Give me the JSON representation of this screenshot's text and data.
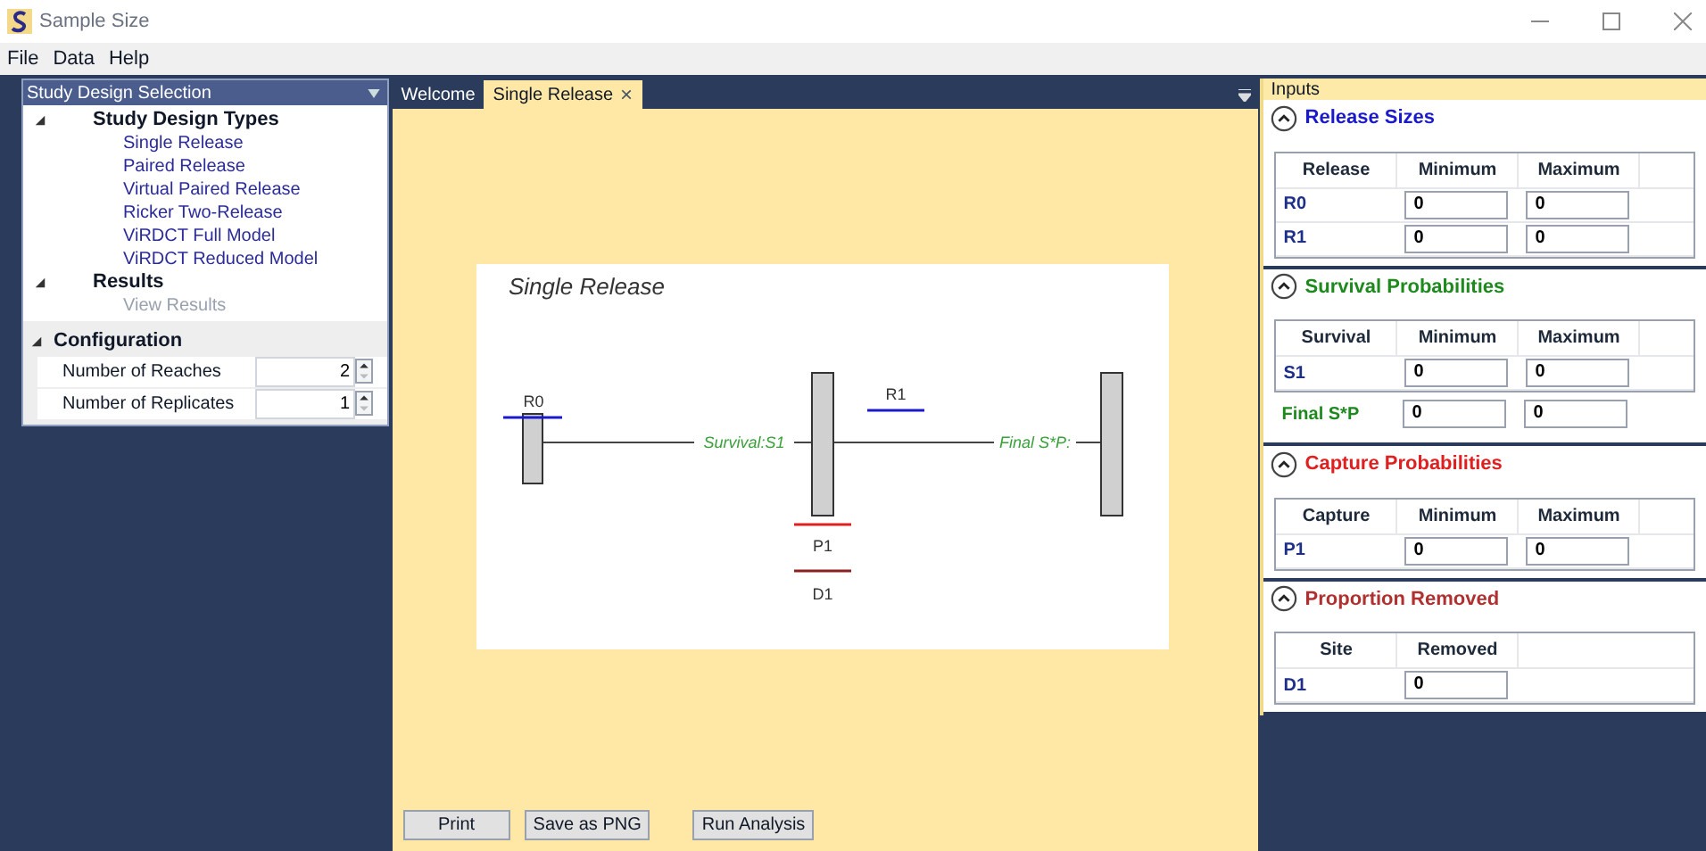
{
  "window": {
    "title": "Sample Size"
  },
  "menu": [
    "File",
    "Data",
    "Help"
  ],
  "left_panel": {
    "title": "Study Design Selection",
    "tree": [
      {
        "label": "Study Design Types",
        "expanded": true,
        "children": [
          {
            "label": "Single Release",
            "disabled": false
          },
          {
            "label": "Paired Release",
            "disabled": false
          },
          {
            "label": "Virtual Paired Release",
            "disabled": false
          },
          {
            "label": "Ricker Two-Release",
            "disabled": false
          },
          {
            "label": "ViRDCT Full Model",
            "disabled": false
          },
          {
            "label": "ViRDCT Reduced Model",
            "disabled": false
          }
        ]
      },
      {
        "label": "Results",
        "expanded": true,
        "children": [
          {
            "label": "View Results",
            "disabled": true
          }
        ]
      }
    ],
    "configuration": {
      "title": "Configuration",
      "expanded": true,
      "rows": [
        {
          "label": "Number of Reaches",
          "value": "2"
        },
        {
          "label": "Number of Replicates",
          "value": "1"
        }
      ]
    }
  },
  "tabs": [
    {
      "label": "Welcome",
      "selected": false,
      "closable": false
    },
    {
      "label": "Single Release",
      "selected": true,
      "closable": true
    }
  ],
  "tab_close": "×",
  "diagram": {
    "title": "Single Release",
    "release_labels": [
      "R0",
      "R1"
    ],
    "survival_label": "Survival:S1",
    "final_label": "Final S*P:",
    "capture_label": "P1",
    "removal_label": "D1"
  },
  "buttons": [
    "Print",
    "Save as PNG",
    "Run Analysis"
  ],
  "inputs": {
    "title": "Inputs",
    "sections": [
      {
        "title": "Release Sizes",
        "color": "#1a1acc",
        "expanded": true,
        "columns": [
          "Release",
          "Minimum",
          "Maximum"
        ],
        "rows": [
          {
            "label": "R0",
            "values": [
              "0",
              "0"
            ]
          },
          {
            "label": "R1",
            "values": [
              "0",
              "0"
            ]
          }
        ]
      },
      {
        "title": "Survival Probabilities",
        "color": "#1e8a1e",
        "expanded": true,
        "columns": [
          "Survival",
          "Minimum",
          "Maximum"
        ],
        "rows": [
          {
            "label": "S1",
            "values": [
              "0",
              "0"
            ]
          }
        ],
        "extra_rows": [
          {
            "label": "Final S*P",
            "values": [
              "0",
              "0"
            ]
          }
        ]
      },
      {
        "title": "Capture Probabilities",
        "color": "#e02020",
        "expanded": true,
        "columns": [
          "Capture",
          "Minimum",
          "Maximum"
        ],
        "rows": [
          {
            "label": "P1",
            "values": [
              "0",
              "0"
            ]
          }
        ]
      },
      {
        "title": "Proportion Removed",
        "color": "#b03030",
        "expanded": true,
        "columns": [
          "Site",
          "Removed"
        ],
        "rows": [
          {
            "label": "D1",
            "values": [
              "0"
            ]
          }
        ]
      }
    ]
  }
}
